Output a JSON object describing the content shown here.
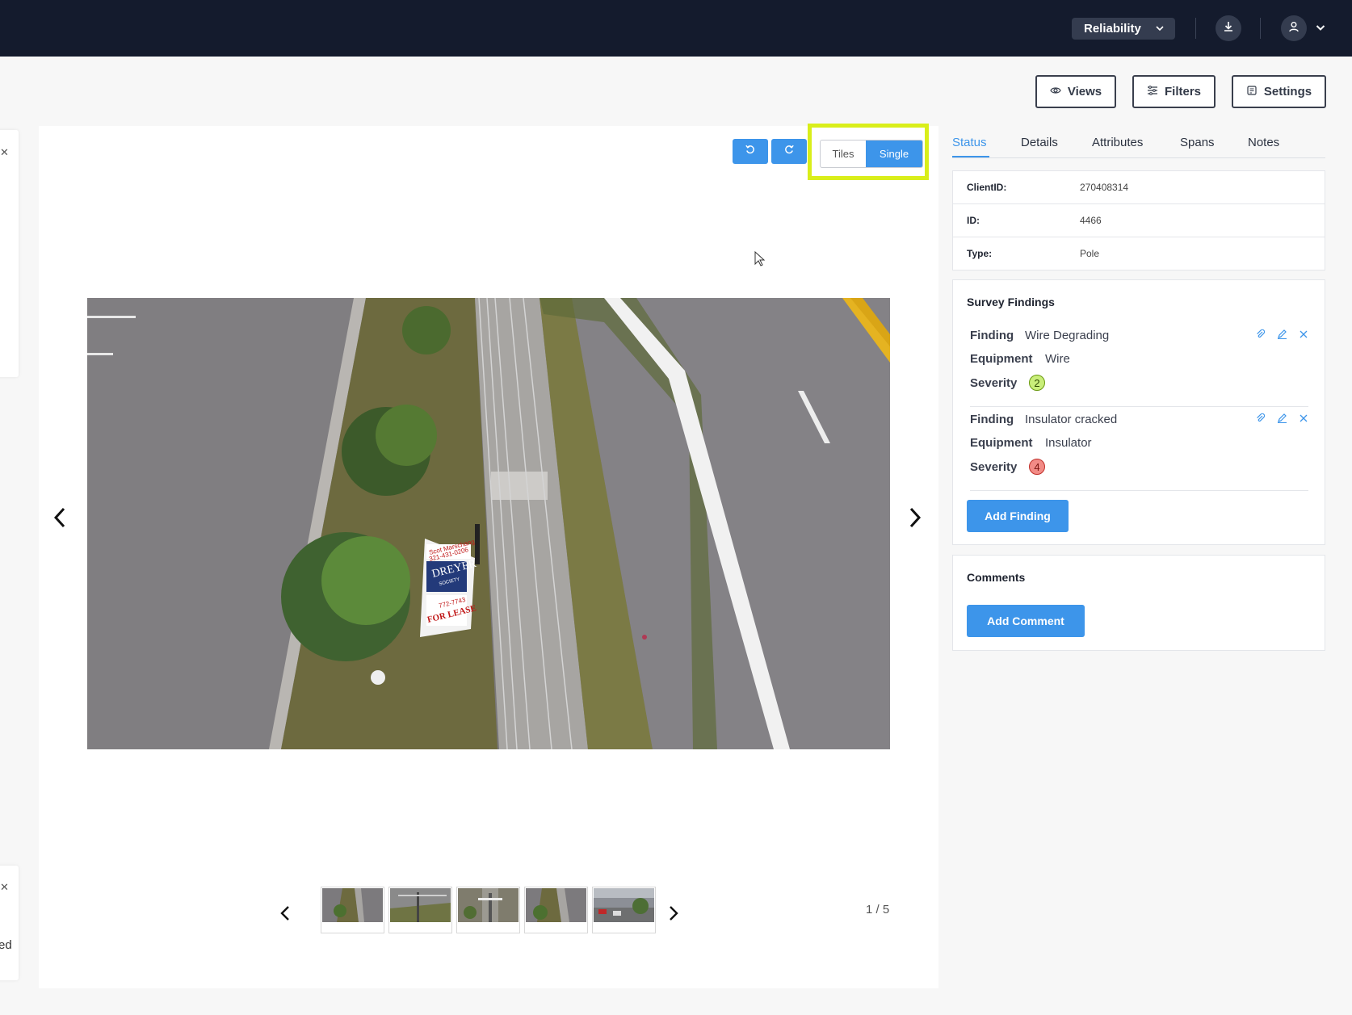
{
  "header": {
    "workspace_label": "Reliability",
    "workspace_icon": "chevron-down-icon",
    "download_icon": "download-icon",
    "user_icon": "user-icon"
  },
  "toolbar": {
    "views_label": "Views",
    "filters_label": "Filters",
    "settings_label": "Settings"
  },
  "viewer": {
    "view_toggle": {
      "tiles_label": "Tiles",
      "single_label": "Single",
      "selected": "Single"
    },
    "counter": "1 / 5",
    "sign_text": [
      "Scot Marschang",
      "321-431-0206",
      "DREYER",
      "SOCIETY",
      "772-7743",
      "FOR LEASE"
    ]
  },
  "tabs": [
    "Status",
    "Details",
    "Attributes",
    "Spans",
    "Notes"
  ],
  "active_tab": "Status",
  "info": [
    {
      "key": "ClientID:",
      "value": "270408314"
    },
    {
      "key": "ID:",
      "value": "4466"
    },
    {
      "key": "Type:",
      "value": "Pole"
    }
  ],
  "survey": {
    "title": "Survey Findings",
    "finding_label": "Finding",
    "equipment_label": "Equipment",
    "severity_label": "Severity",
    "findings": [
      {
        "finding": "Wire Degrading",
        "equipment": "Wire",
        "severity": "2",
        "severity_color": "#c9ee7a",
        "severity_border": "#6b9a10"
      },
      {
        "finding": "Insulator cracked",
        "equipment": "Insulator",
        "severity": "4",
        "severity_color": "#f28b86",
        "severity_border": "#c0302a"
      }
    ],
    "add_label": "Add Finding"
  },
  "comments": {
    "title": "Comments",
    "add_label": "Add Comment"
  },
  "left_stub": {
    "text": "ed"
  },
  "colors": {
    "accent": "#3d95ea",
    "topbar": "#141b2d",
    "highlight": "#d9ee1a"
  }
}
